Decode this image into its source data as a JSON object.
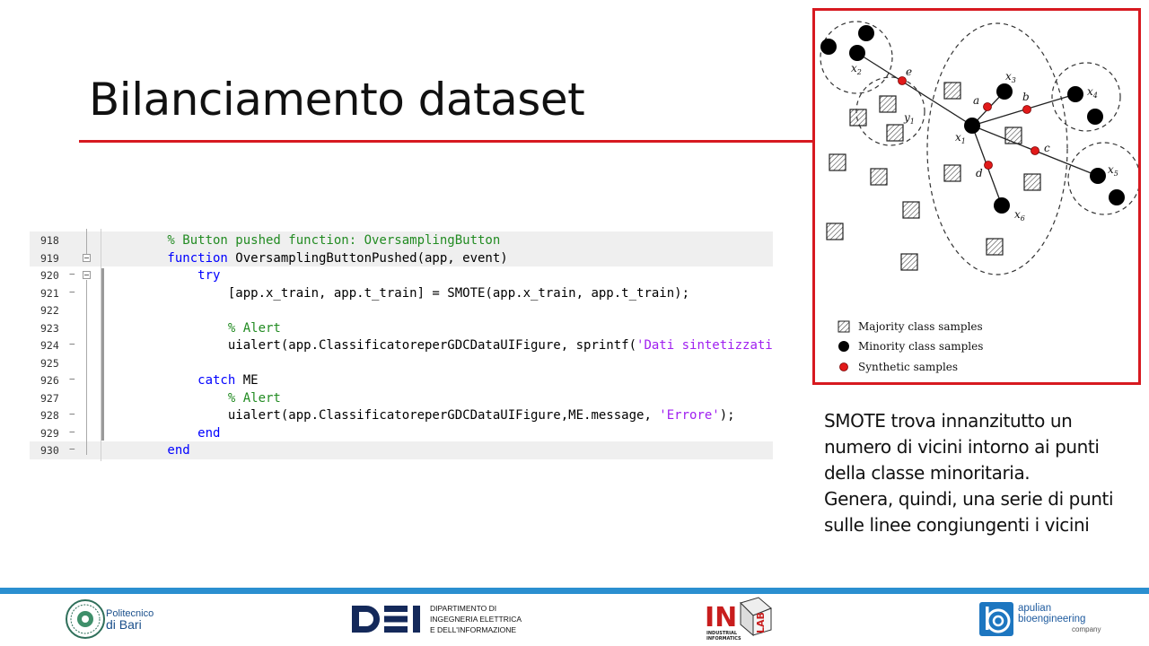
{
  "slide": {
    "title": "Bilanciamento dataset",
    "description": [
      "SMOTE trova innanzitutto un",
      "numero di vicini intorno ai punti",
      "della classe minoritaria.",
      "Genera, quindi, una serie di punti",
      "sulle linee congiungenti i vicini"
    ]
  },
  "code": {
    "lines": [
      {
        "num": "918",
        "mark": "",
        "highlight": true,
        "parts": [
          {
            "cls": "cm",
            "text": "        % Button pushed function: OversamplingButton"
          }
        ]
      },
      {
        "num": "919",
        "mark": "",
        "highlight": true,
        "parts": [
          {
            "cls": "kw",
            "text": "        function"
          },
          {
            "cls": "",
            "text": " OversamplingButtonPushed(app, event)"
          }
        ]
      },
      {
        "num": "920",
        "mark": "−",
        "highlight": false,
        "parts": [
          {
            "cls": "kw",
            "text": "            try"
          }
        ]
      },
      {
        "num": "921",
        "mark": "−",
        "highlight": false,
        "parts": [
          {
            "cls": "",
            "text": "                [app.x_train, app.t_train] = SMOTE(app.x_train, app.t_train);"
          }
        ]
      },
      {
        "num": "922",
        "mark": "",
        "highlight": false,
        "parts": []
      },
      {
        "num": "923",
        "mark": "",
        "highlight": false,
        "parts": [
          {
            "cls": "cm",
            "text": "                % Alert"
          }
        ]
      },
      {
        "num": "924",
        "mark": "−",
        "highlight": false,
        "parts": [
          {
            "cls": "",
            "text": "                uialert(app.ClassificatoreperGDCDataUIFigure, sprintf("
          },
          {
            "cls": "st",
            "text": "'Dati sintetizzati c"
          }
        ]
      },
      {
        "num": "925",
        "mark": "",
        "highlight": false,
        "parts": []
      },
      {
        "num": "926",
        "mark": "−",
        "highlight": false,
        "parts": [
          {
            "cls": "kw",
            "text": "            catch"
          },
          {
            "cls": "",
            "text": " ME"
          }
        ]
      },
      {
        "num": "927",
        "mark": "",
        "highlight": false,
        "parts": [
          {
            "cls": "cm",
            "text": "                % Alert"
          }
        ]
      },
      {
        "num": "928",
        "mark": "−",
        "highlight": false,
        "parts": [
          {
            "cls": "",
            "text": "                uialert(app.ClassificatoreperGDCDataUIFigure,ME.message, "
          },
          {
            "cls": "st",
            "text": "'Errore'"
          },
          {
            "cls": "",
            "text": ");"
          }
        ]
      },
      {
        "num": "929",
        "mark": "−",
        "highlight": false,
        "parts": [
          {
            "cls": "kw",
            "text": "            end"
          }
        ]
      },
      {
        "num": "930",
        "mark": "−",
        "highlight": true,
        "parts": [
          {
            "cls": "kw",
            "text": "        end"
          }
        ]
      }
    ]
  },
  "figure": {
    "labels": {
      "x1": "x1",
      "x2": "x2",
      "x3": "x3",
      "x4": "x4",
      "x5": "x5",
      "x6": "x6",
      "y1": "y1",
      "a": "a",
      "b": "b",
      "c": "c",
      "d": "d",
      "e": "e"
    },
    "legend": {
      "majority": "Majority class samples",
      "minority": "Minority class samples",
      "synthetic": "Synthetic samples"
    },
    "colors": {
      "border": "#d71920",
      "synthetic": "#e11a1a",
      "minority": "#000000"
    }
  },
  "footer": {
    "poliba": {
      "line1": "Politecnico",
      "line2": "di Bari"
    },
    "dei": {
      "logo_text": "DEI",
      "line1": "DIPARTIMENTO DI",
      "line2": "INGEGNERIA ELETTRICA",
      "line3": "E DELL'INFORMAZIONE"
    },
    "inlab": {
      "logo_text": "IN LAB",
      "sub1": "INDUSTRIAL",
      "sub2": "INFORMATICS"
    },
    "abc": {
      "line1": "apulian",
      "line2": "bioengineering",
      "line3": "company"
    },
    "bar_color": "#2b8fd0"
  }
}
